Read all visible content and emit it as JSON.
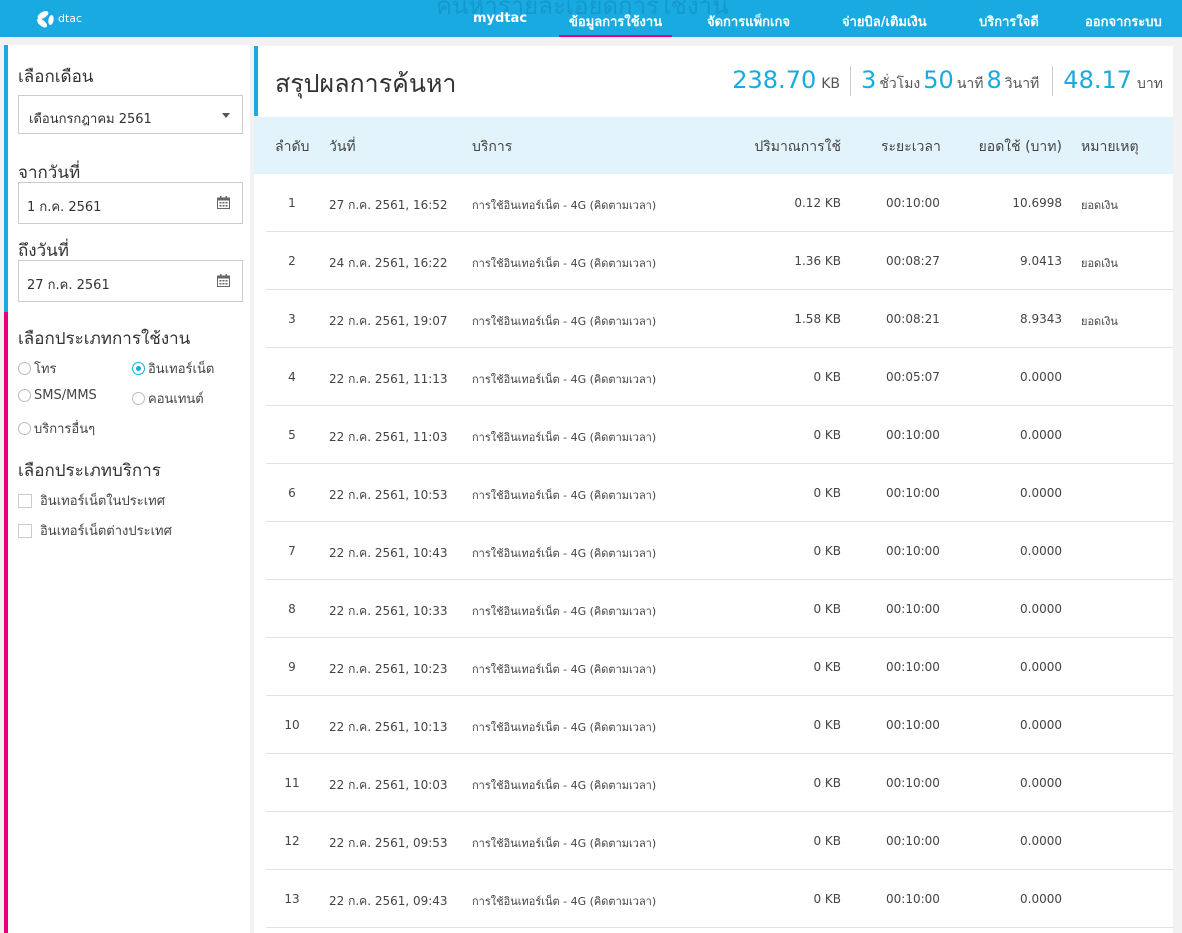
{
  "header": {
    "ghost_title": "ค้นหารายละเอียดการใช้งาน",
    "logo_text": "dtac",
    "nav": [
      {
        "label": "mydtac",
        "active": false
      },
      {
        "label": "ข้อมูลการใช้งาน",
        "active": true
      },
      {
        "label": "จัดการแพ็กเกจ",
        "active": false
      },
      {
        "label": "จ่ายบิล/เติมเงิน",
        "active": false
      },
      {
        "label": "บริการใจดี",
        "active": false
      },
      {
        "label": "ออกจากระบบ",
        "active": false
      }
    ]
  },
  "sidebar": {
    "month_label": "เลือกเดือน",
    "month_value": "เดือนกรกฎาคม 2561",
    "from_label": "จากวันที่",
    "from_value": "1 ก.ค. 2561",
    "to_label": "ถึงวันที่",
    "to_value": "27 ก.ค. 2561",
    "usage_type_label": "เลือกประเภทการใช้งาน",
    "usage_types": [
      {
        "label": "โทร",
        "checked": false
      },
      {
        "label": "อินเทอร์เน็ต",
        "checked": true
      },
      {
        "label": "SMS/MMS",
        "checked": false
      },
      {
        "label": "คอนเทนต์",
        "checked": false
      },
      {
        "label": "บริการอื่นๆ",
        "checked": false
      }
    ],
    "service_type_label": "เลือกประเภทบริการ",
    "service_types": [
      {
        "label": "อินเทอร์เน็ตในประเทศ",
        "checked": false
      },
      {
        "label": "อินเทอร์เน็ตต่างประเทศ",
        "checked": false
      }
    ]
  },
  "main": {
    "title": "สรุปผลการค้นหา",
    "summary": {
      "volume": "238.70",
      "volume_unit": "KB",
      "hours": "3",
      "hours_unit": "ชั่วโมง",
      "minutes": "50",
      "minutes_unit": "นาที",
      "seconds": "8",
      "seconds_unit": "วินาที",
      "amount": "48.17",
      "amount_unit": "บาท"
    },
    "columns": {
      "no": "ลำดับ",
      "date": "วันที่",
      "service": "บริการ",
      "volume": "ปริมาณการใช้",
      "duration": "ระยะเวลา",
      "amount": "ยอดใช้ (บาท)",
      "note": "หมายเหตุ"
    },
    "rows": [
      {
        "no": "1",
        "date": "27 ก.ค. 2561, 16:52",
        "service": "การใช้อินเทอร์เน็ต - 4G (คิดตามเวลา)",
        "volume": "0.12 KB",
        "duration": "00:10:00",
        "amount": "10.6998",
        "note": "ยอดเงิน"
      },
      {
        "no": "2",
        "date": "24 ก.ค. 2561, 16:22",
        "service": "การใช้อินเทอร์เน็ต - 4G (คิดตามเวลา)",
        "volume": "1.36 KB",
        "duration": "00:08:27",
        "amount": "9.0413",
        "note": "ยอดเงิน"
      },
      {
        "no": "3",
        "date": "22 ก.ค. 2561, 19:07",
        "service": "การใช้อินเทอร์เน็ต - 4G (คิดตามเวลา)",
        "volume": "1.58 KB",
        "duration": "00:08:21",
        "amount": "8.9343",
        "note": "ยอดเงิน"
      },
      {
        "no": "4",
        "date": "22 ก.ค. 2561, 11:13",
        "service": "การใช้อินเทอร์เน็ต - 4G (คิดตามเวลา)",
        "volume": "0 KB",
        "duration": "00:05:07",
        "amount": "0.0000",
        "note": ""
      },
      {
        "no": "5",
        "date": "22 ก.ค. 2561, 11:03",
        "service": "การใช้อินเทอร์เน็ต - 4G (คิดตามเวลา)",
        "volume": "0 KB",
        "duration": "00:10:00",
        "amount": "0.0000",
        "note": ""
      },
      {
        "no": "6",
        "date": "22 ก.ค. 2561, 10:53",
        "service": "การใช้อินเทอร์เน็ต - 4G (คิดตามเวลา)",
        "volume": "0 KB",
        "duration": "00:10:00",
        "amount": "0.0000",
        "note": ""
      },
      {
        "no": "7",
        "date": "22 ก.ค. 2561, 10:43",
        "service": "การใช้อินเทอร์เน็ต - 4G (คิดตามเวลา)",
        "volume": "0 KB",
        "duration": "00:10:00",
        "amount": "0.0000",
        "note": ""
      },
      {
        "no": "8",
        "date": "22 ก.ค. 2561, 10:33",
        "service": "การใช้อินเทอร์เน็ต - 4G (คิดตามเวลา)",
        "volume": "0 KB",
        "duration": "00:10:00",
        "amount": "0.0000",
        "note": ""
      },
      {
        "no": "9",
        "date": "22 ก.ค. 2561, 10:23",
        "service": "การใช้อินเทอร์เน็ต - 4G (คิดตามเวลา)",
        "volume": "0 KB",
        "duration": "00:10:00",
        "amount": "0.0000",
        "note": ""
      },
      {
        "no": "10",
        "date": "22 ก.ค. 2561, 10:13",
        "service": "การใช้อินเทอร์เน็ต - 4G (คิดตามเวลา)",
        "volume": "0 KB",
        "duration": "00:10:00",
        "amount": "0.0000",
        "note": ""
      },
      {
        "no": "11",
        "date": "22 ก.ค. 2561, 10:03",
        "service": "การใช้อินเทอร์เน็ต - 4G (คิดตามเวลา)",
        "volume": "0 KB",
        "duration": "00:10:00",
        "amount": "0.0000",
        "note": ""
      },
      {
        "no": "12",
        "date": "22 ก.ค. 2561, 09:53",
        "service": "การใช้อินเทอร์เน็ต - 4G (คิดตามเวลา)",
        "volume": "0 KB",
        "duration": "00:10:00",
        "amount": "0.0000",
        "note": ""
      },
      {
        "no": "13",
        "date": "22 ก.ค. 2561, 09:43",
        "service": "การใช้อินเทอร์เน็ต - 4G (คิดตามเวลา)",
        "volume": "0 KB",
        "duration": "00:10:00",
        "amount": "0.0000",
        "note": ""
      }
    ]
  },
  "colors": {
    "brand_blue": "#19aae1",
    "accent_pink": "#e6007e"
  }
}
